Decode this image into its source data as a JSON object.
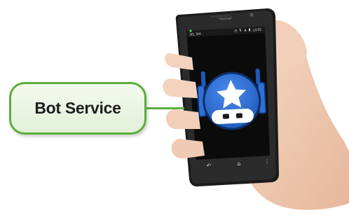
{
  "callout": {
    "label": "Bot Service"
  },
  "phone": {
    "brand": "Neoreal",
    "status_bar": {
      "carrier": "3G, 9/4",
      "icons": "◷ ⇅ ▲ ▮",
      "time": "13:02"
    },
    "app_icon": "bot-service-robot-icon",
    "nav": {
      "back": "↶",
      "home": "⌂",
      "menu": "⋮"
    }
  },
  "colors": {
    "callout_border": "#5aae3c",
    "callout_fill": "#e2f0d9",
    "icon_blue": "#2f6fd6",
    "screen": "#0b0b0b"
  }
}
